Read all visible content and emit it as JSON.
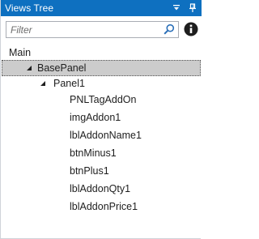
{
  "window": {
    "title": "Views Tree",
    "dropdown_icon": "chevron-down-icon",
    "pin_icon": "pin-icon",
    "accent_color": "#0e70c0"
  },
  "search": {
    "placeholder": "Filter",
    "value": "",
    "search_icon": "search-icon",
    "info_icon": "info-icon"
  },
  "tree": {
    "root": "Main",
    "base_panel": "BasePanel",
    "panel1": "Panel1",
    "children": [
      "PNLTagAddOn",
      "imgAddon1",
      "lblAddonName1",
      "btnMinus1",
      "btnPlus1",
      "lblAddonQty1",
      "lblAddonPrice1"
    ]
  }
}
